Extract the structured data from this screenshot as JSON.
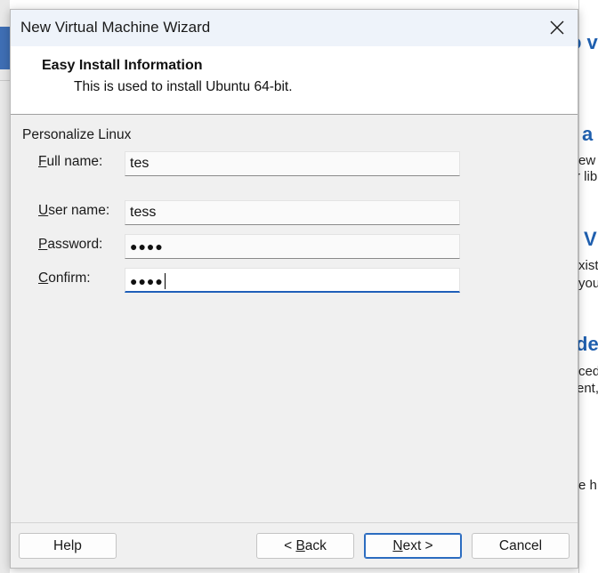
{
  "window": {
    "title": "New Virtual Machine Wizard"
  },
  "header": {
    "title": "Easy Install Information",
    "subtitle": "This is used to install Ubuntu 64-bit."
  },
  "section": {
    "label": "Personalize Linux"
  },
  "fields": {
    "full_name": {
      "mnemonic": "F",
      "label_rest": "ull name:",
      "value": "tes"
    },
    "user_name": {
      "mnemonic": "U",
      "label_rest": "ser name:",
      "value": "tess"
    },
    "password": {
      "mnemonic": "P",
      "label_rest": "assword:",
      "value": "●●●●"
    },
    "confirm": {
      "mnemonic": "C",
      "label_rest": "onfirm:",
      "value": "●●●●"
    }
  },
  "buttons": {
    "help": "Help",
    "back_prefix": "< ",
    "back_mnemonic": "B",
    "back_rest": "ack",
    "next_mnemonic": "N",
    "next_rest": "ext >",
    "cancel": "Cancel"
  },
  "background_fragments": [
    {
      "text": "o v"
    },
    {
      "text": "a"
    },
    {
      "text": "ew"
    },
    {
      "text": "r lib"
    },
    {
      "text": "V"
    },
    {
      "text": "xist"
    },
    {
      "text": "you"
    },
    {
      "text": "de"
    },
    {
      "text": "ced"
    },
    {
      "text": "ent,"
    },
    {
      "text": "e h"
    }
  ],
  "colors": {
    "accent": "#1f5fb9",
    "background_heading": "#1f5fae"
  },
  "icons": {
    "close": "close-icon"
  }
}
